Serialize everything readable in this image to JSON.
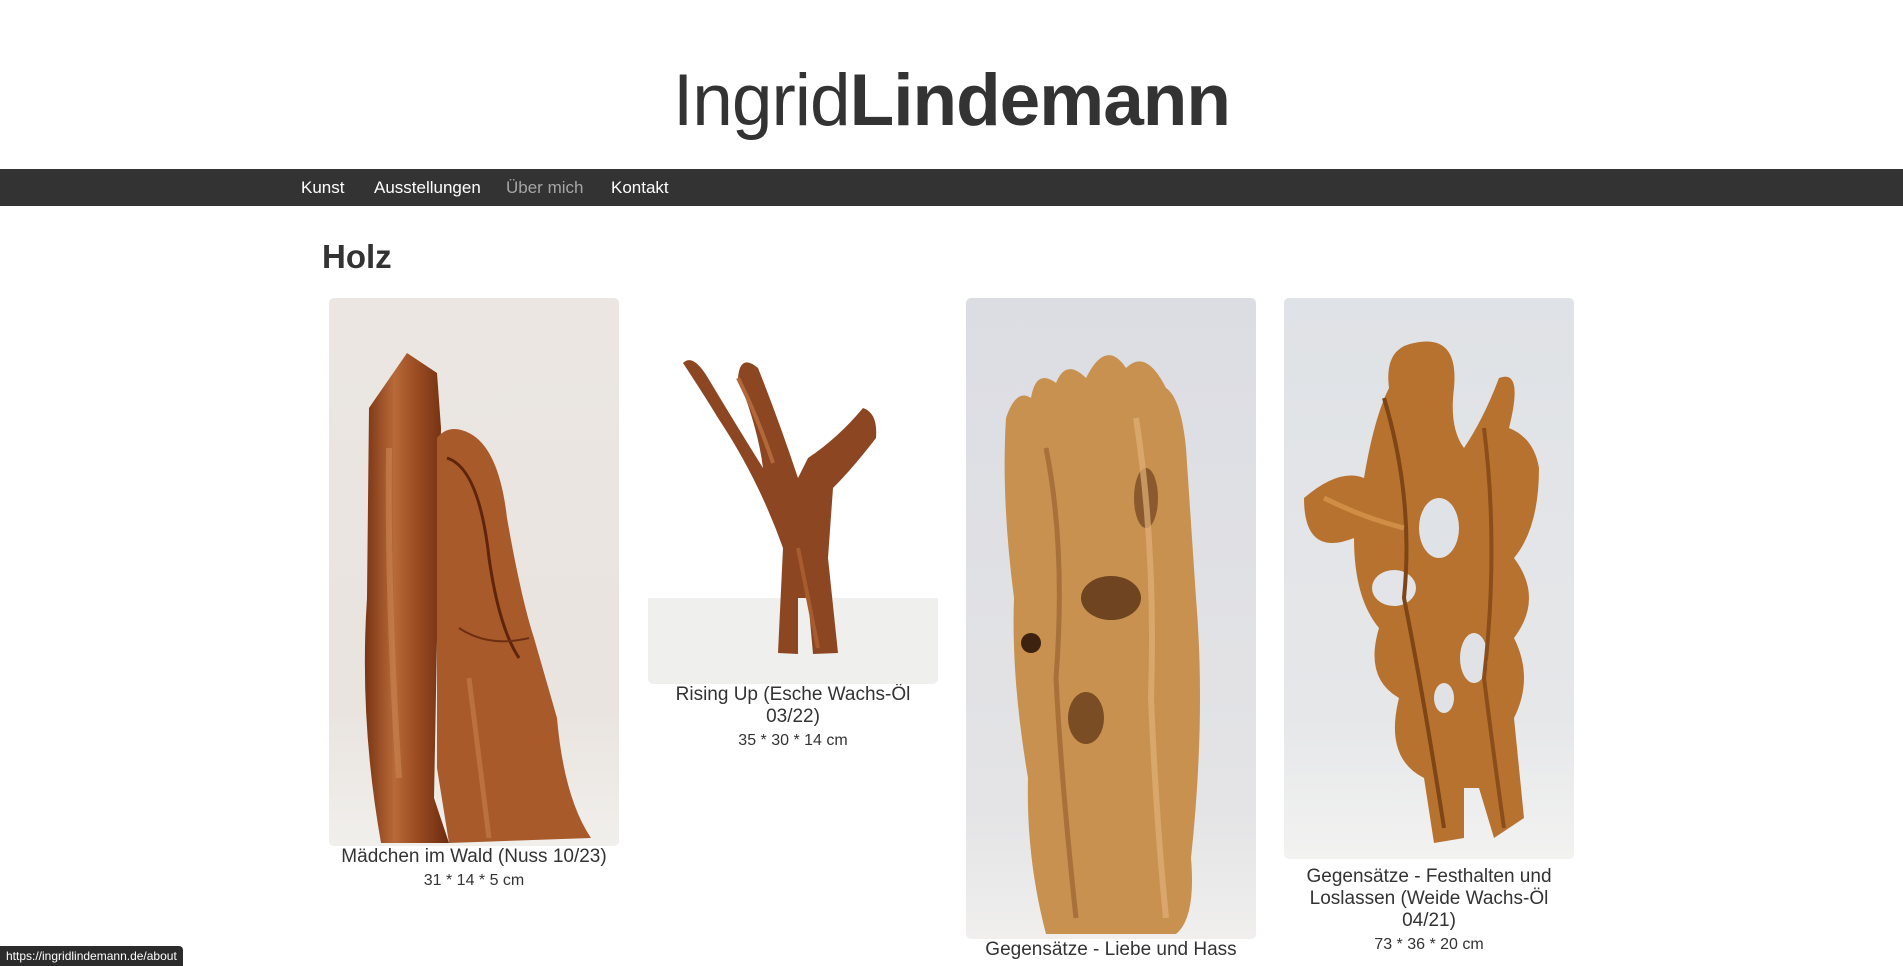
{
  "header": {
    "logo_first": "Ingrid",
    "logo_last": "Lindemann"
  },
  "nav": {
    "items": [
      {
        "label": "Kunst"
      },
      {
        "label": "Ausstellungen"
      },
      {
        "label": "Über mich"
      },
      {
        "label": "Kontakt"
      }
    ],
    "active_index": 2
  },
  "main": {
    "title": "Holz",
    "artworks": [
      {
        "caption": "Mädchen im Wald (Nuss 10/23)",
        "dims": "31 * 14 * 5 cm"
      },
      {
        "caption": "Rising Up (Esche Wachs-Öl 03/22)",
        "dims": "35 * 30 * 14 cm"
      },
      {
        "caption": "Gegensätze - Liebe und Hass",
        "dims": ""
      },
      {
        "caption": "Gegensätze - Festhalten und Loslassen (Weide Wachs-Öl 04/21)",
        "dims": "73 * 36 * 20 cm"
      }
    ]
  },
  "status_bar": {
    "url": "https://ingridlindemann.de/about"
  },
  "colors": {
    "nav_bg": "#333333",
    "nav_text": "#ffffff",
    "nav_active": "#a6a6a6",
    "text": "#333333"
  }
}
